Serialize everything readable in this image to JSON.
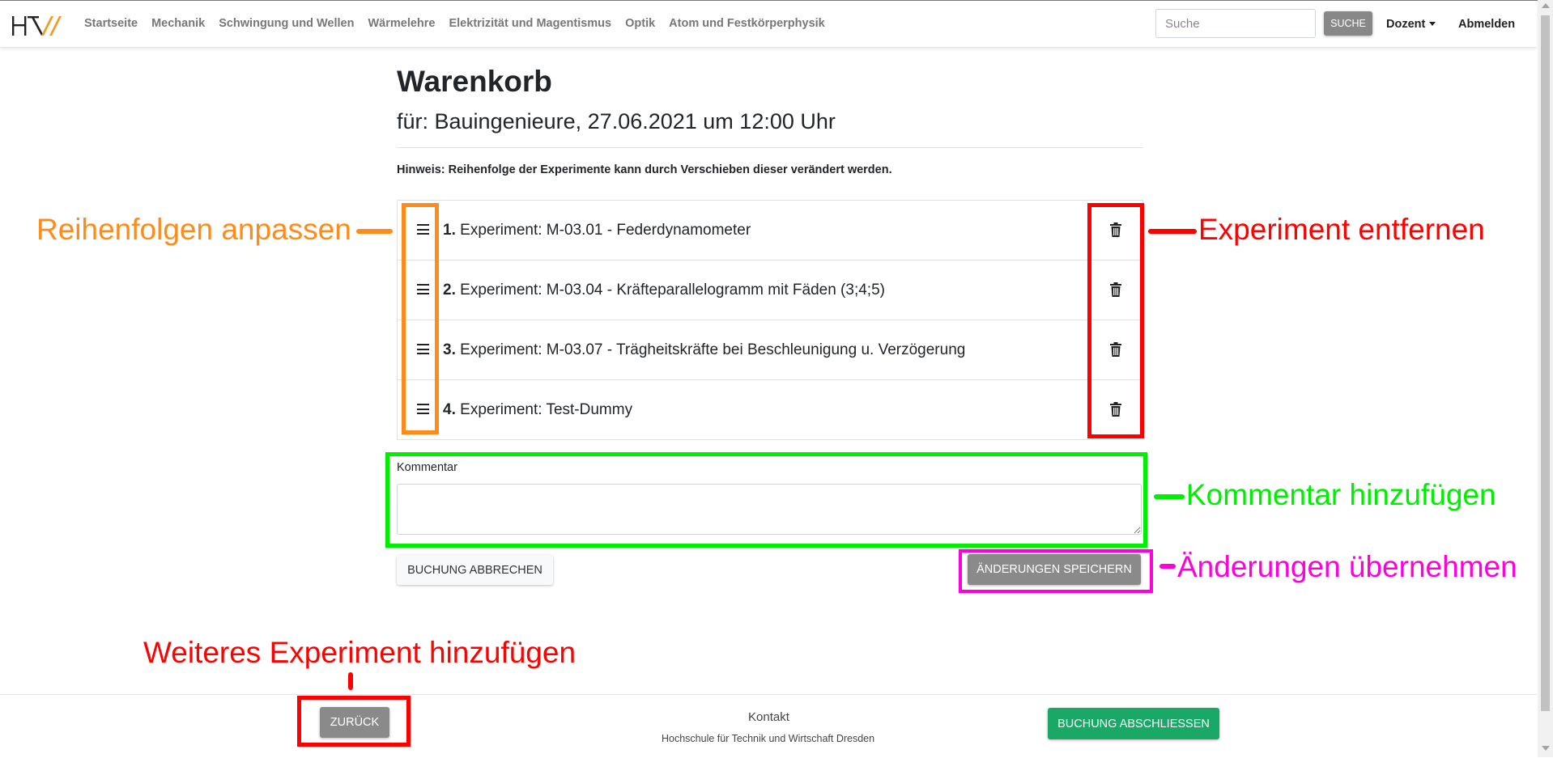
{
  "colors": {
    "annotation_orange": "#ff8c1a",
    "annotation_red": "#ff0000",
    "annotation_green": "#00ee00",
    "annotation_magenta": "#ff00dd",
    "finish_button": "#1aa866",
    "gray_button": "#8a8a8a",
    "logo_accent": "#f29a21"
  },
  "navbar": {
    "logo_icon": "htw-logo-icon",
    "links": [
      "Startseite",
      "Mechanik",
      "Schwingung und Wellen",
      "Wärmelehre",
      "Elektrizität und Magentismus",
      "Optik",
      "Atom und Festkörperphysik"
    ],
    "search_placeholder": "Suche",
    "search_button": "SUCHE",
    "dozent": "Dozent",
    "logout": "Abmelden"
  },
  "page": {
    "title": "Warenkorb",
    "subtitle": "für: Bauingenieure, 27.06.2021 um 12:00 Uhr",
    "hint": "Hinweis: Reihenfolge der Experimente kann durch Verschieben dieser verändert werden."
  },
  "experiments": [
    {
      "num": "1.",
      "text": "Experiment: M-03.01 - Federdynamometer"
    },
    {
      "num": "2.",
      "text": "Experiment: M-03.04 - Kräfteparallelogramm mit Fäden (3;4;5)"
    },
    {
      "num": "3.",
      "text": "Experiment: M-03.07 - Trägheitskräfte bei Beschleunigung u. Verzögerung"
    },
    {
      "num": "4.",
      "text": "Experiment: Test-Dummy"
    }
  ],
  "comment": {
    "label": "Kommentar",
    "value": ""
  },
  "buttons": {
    "cancel_booking": "BUCHUNG ABBRECHEN",
    "save_changes": "ÄNDERUNGEN SPEICHERN",
    "back": "ZURÜCK",
    "finish_booking": "BUCHUNG ABSCHLIESSEN"
  },
  "footer": {
    "contact": "Kontakt",
    "organization": "Hochschule für Technik und Wirtschaft Dresden"
  },
  "annotations": {
    "reorder": "Reihenfolgen anpassen",
    "remove": "Experiment entfernen",
    "comment": "Kommentar hinzufügen",
    "apply": "Änderungen übernehmen",
    "add_more": "Weiteres Experiment hinzufügen"
  }
}
